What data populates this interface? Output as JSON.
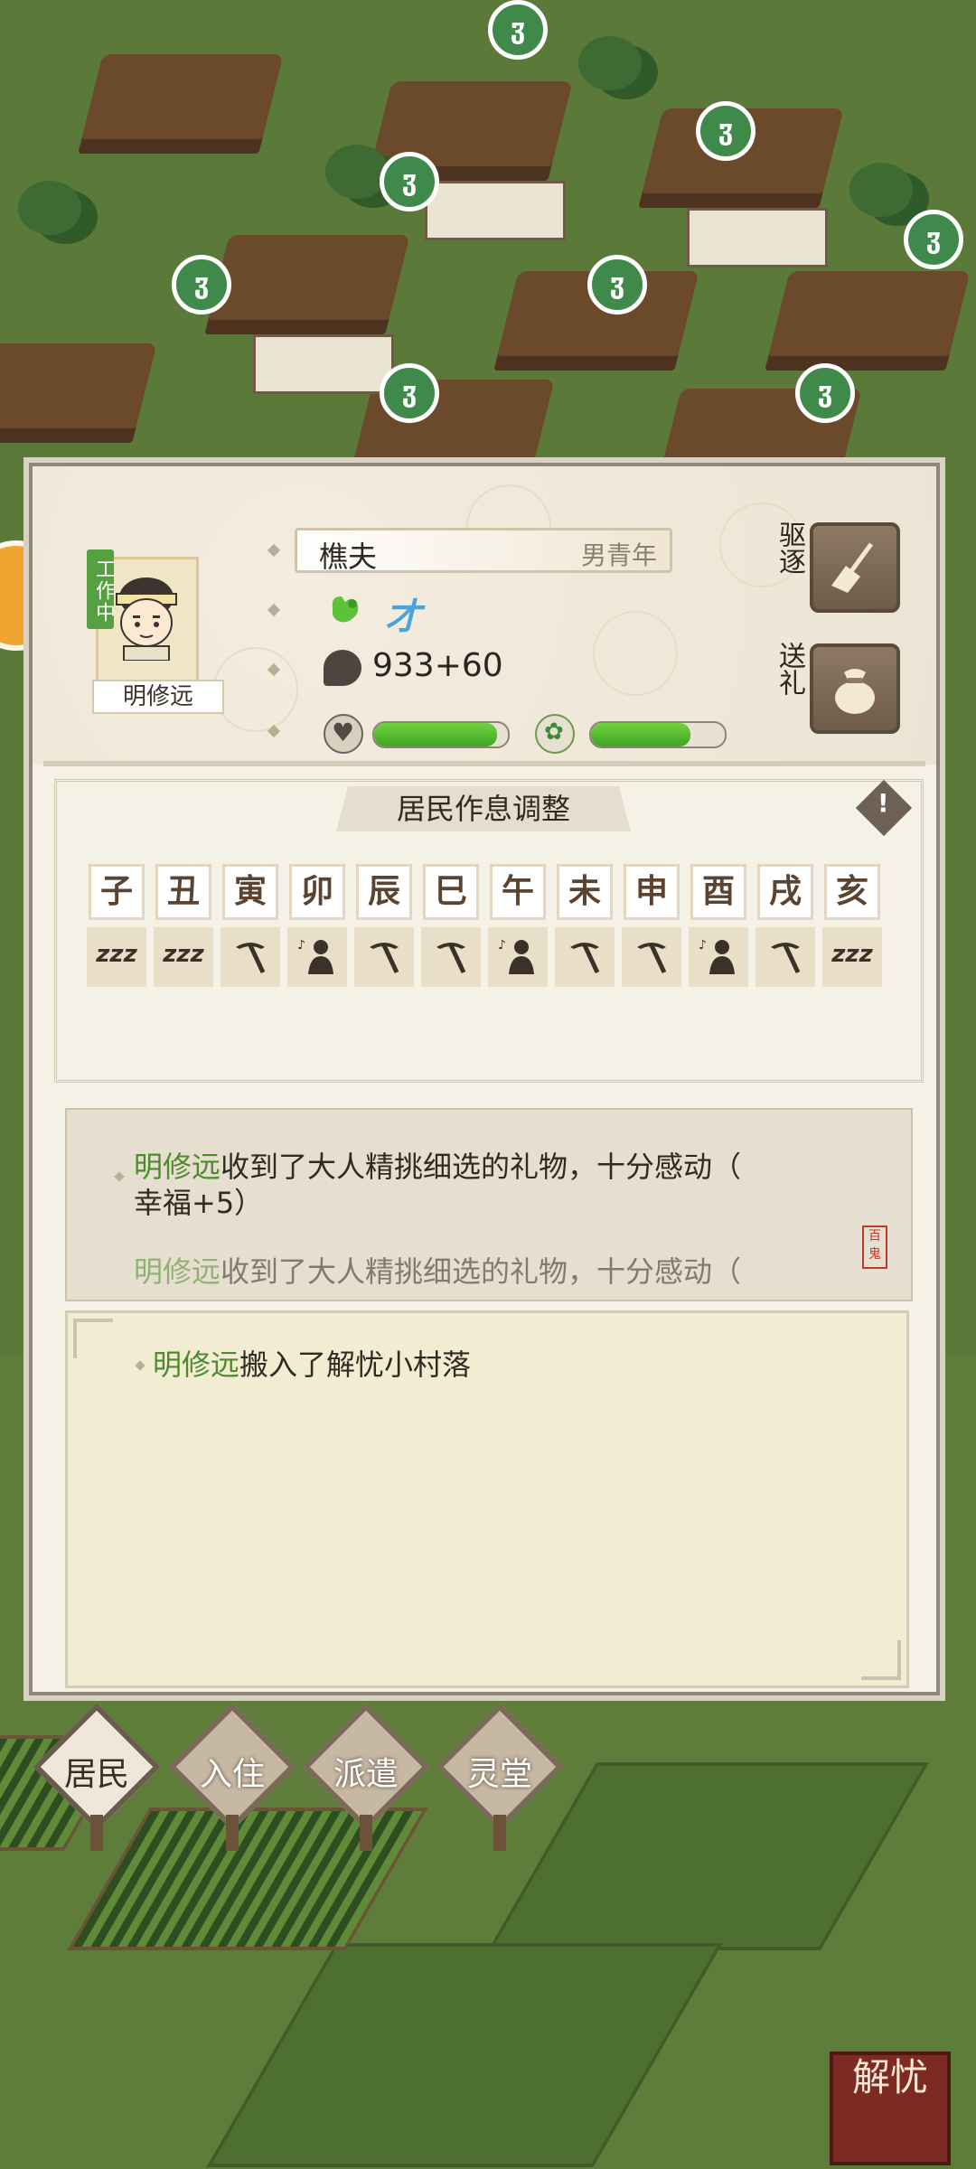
{
  "resident": {
    "name": "明修远",
    "status": "工作中",
    "job": "樵夫",
    "desc": "男青年",
    "traits": [
      "fist-icon",
      "talent-icon"
    ],
    "trait2_label": "才",
    "coins": "933+60",
    "health_pct": 92,
    "happiness_pct": 74
  },
  "actions": {
    "expel_label": "驱逐",
    "gift_label": "送礼"
  },
  "schedule": {
    "title": "居民作息调整",
    "hours": [
      "子",
      "丑",
      "寅",
      "卯",
      "辰",
      "巳",
      "午",
      "未",
      "申",
      "酉",
      "戌",
      "亥"
    ],
    "activities": [
      "sleep",
      "sleep",
      "work",
      "rest",
      "work",
      "work",
      "rest",
      "work",
      "work",
      "rest",
      "work",
      "sleep"
    ],
    "sleep_glyph": "zzz"
  },
  "log_recent": {
    "name": "明修远",
    "text1": "收到了大人精挑细选的礼物，十分感动（",
    "text2": "幸福+5）",
    "text3": "收到了大人精挑细选的礼物，十分感动（",
    "stamp": "百鬼"
  },
  "log_history": {
    "name": "明修远",
    "text": "搬入了解忧小村落"
  },
  "nav": {
    "items": [
      "居民",
      "入住",
      "派遣",
      "灵堂"
    ],
    "active": 0
  },
  "logo": "解忧",
  "colors": {
    "accent_green": "#4f8a2e",
    "bar_green": "#3ea622",
    "status_tag": "#55a142"
  }
}
